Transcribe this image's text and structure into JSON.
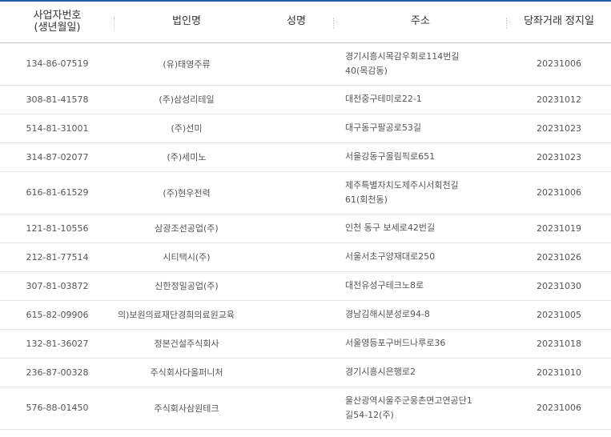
{
  "table": {
    "headers": {
      "biz_no_line1": "사업자번호",
      "biz_no_line2": "(생년월일)",
      "corp_name": "법인명",
      "name": "성명",
      "address": "주소",
      "stop_date": "당좌거래 정지일"
    },
    "rows": [
      {
        "biz_no": "134-86-07519",
        "corp": "(유)태영주류",
        "name": "",
        "addr1": "경기시흥시목감우회로114번길",
        "addr2": "40(목감동)",
        "date": "20231006"
      },
      {
        "biz_no": "308-81-41578",
        "corp": "(주)삼성리테일",
        "name": "",
        "addr1": "대전중구테미로22-1",
        "addr2": "",
        "date": "20231012"
      },
      {
        "biz_no": "514-81-31001",
        "corp": "(주)선미",
        "name": "",
        "addr1": "대구동구팔공로53길",
        "addr2": "",
        "date": "20231023"
      },
      {
        "biz_no": "314-87-02077",
        "corp": "(주)세미노",
        "name": "",
        "addr1": "서울강동구올림픽로651",
        "addr2": "",
        "date": "20231023"
      },
      {
        "biz_no": "616-81-61529",
        "corp": "(주)현우전력",
        "name": "",
        "addr1": "제주특별자치도제주시서회천길",
        "addr2": "61(회천동)",
        "date": "20231006"
      },
      {
        "biz_no": "121-81-10556",
        "corp": "삼광조선공업(주)",
        "name": "",
        "addr1": "인천 동구 보세로42번길",
        "addr2": "",
        "date": "20231019"
      },
      {
        "biz_no": "212-81-77514",
        "corp": "시티택시(주)",
        "name": "",
        "addr1": "서울서초구양재대로250",
        "addr2": "",
        "date": "20231026"
      },
      {
        "biz_no": "307-81-03872",
        "corp": "신한정밀공업(주)",
        "name": "",
        "addr1": "대전유성구테크노8로",
        "addr2": "",
        "date": "20231030"
      },
      {
        "biz_no": "615-82-09906",
        "corp": "의)보원의료재단경희의료원교육",
        "name": "",
        "addr1": "경남김해시분성로94-8",
        "addr2": "",
        "date": "20231005"
      },
      {
        "biz_no": "132-81-36027",
        "corp": "정본건설주식회사",
        "name": "",
        "addr1": "서울영등포구버드나루로36",
        "addr2": "",
        "date": "20231018"
      },
      {
        "biz_no": "236-87-00328",
        "corp": "주식회사다올퍼니처",
        "name": "",
        "addr1": "경기시흥시은행로2",
        "addr2": "",
        "date": "20231010"
      },
      {
        "biz_no": "576-88-01450",
        "corp": "주식회사삼원테크",
        "name": "",
        "addr1": "울산광역시울주군웅촌면고연공단1",
        "addr2": "길54-12(주)",
        "date": "20231006"
      }
    ]
  },
  "colors": {
    "header_rule": "#1f5fa8",
    "row_border": "#e4e4e4"
  }
}
